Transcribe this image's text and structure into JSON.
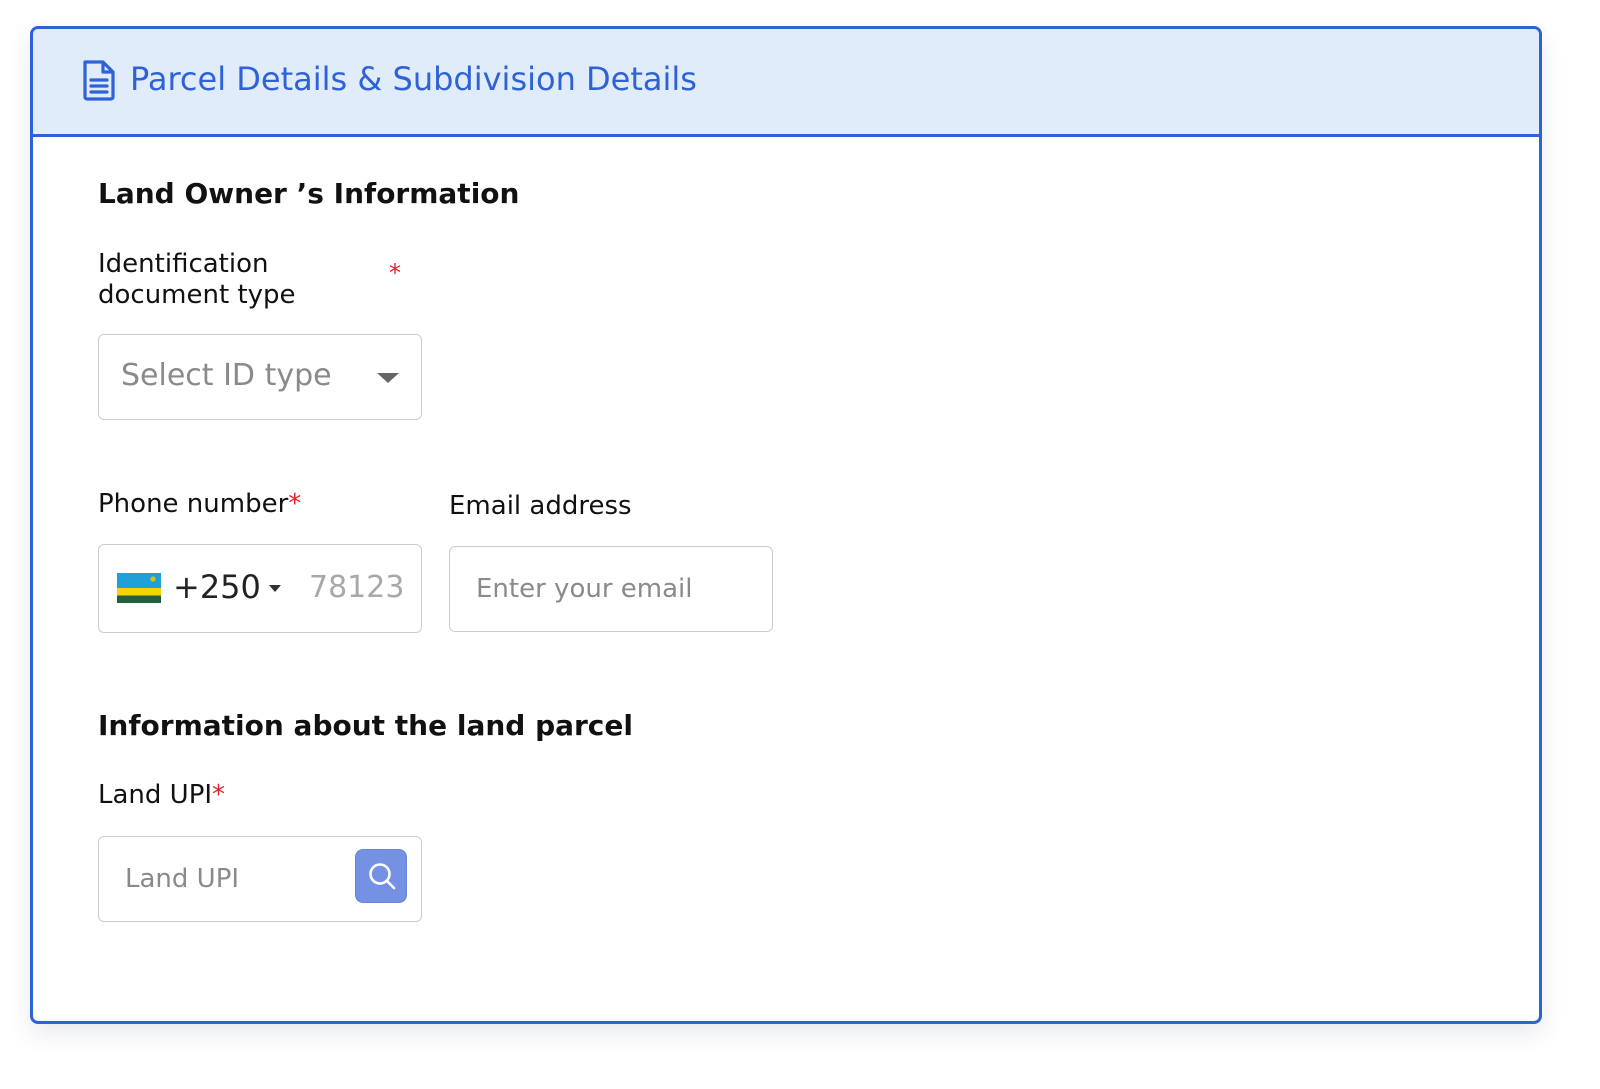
{
  "header": {
    "icon": "document-icon",
    "title": "Parcel Details & Subdivision Details"
  },
  "owner_section": {
    "title": "Land Owner ’s Information",
    "id_type": {
      "label_line1": "Identification",
      "label_line2": "document type",
      "required_mark": "*",
      "placeholder": "Select ID type"
    },
    "phone": {
      "label": "Phone number",
      "required_mark": "*",
      "country_flag": "rwanda-flag-icon",
      "dial_code": "+250",
      "placeholder": "78123"
    },
    "email": {
      "label": "Email address",
      "placeholder": "Enter your email"
    }
  },
  "parcel_section": {
    "title": "Information about the land parcel",
    "upi": {
      "label": "Land UPI",
      "required_mark": "*",
      "placeholder": "Land UPI",
      "search_icon": "search-icon"
    }
  },
  "colors": {
    "accent": "#2f62d6",
    "header_bg": "#e0ecf9",
    "required": "#e0202e",
    "search_button": "#7491e3"
  }
}
